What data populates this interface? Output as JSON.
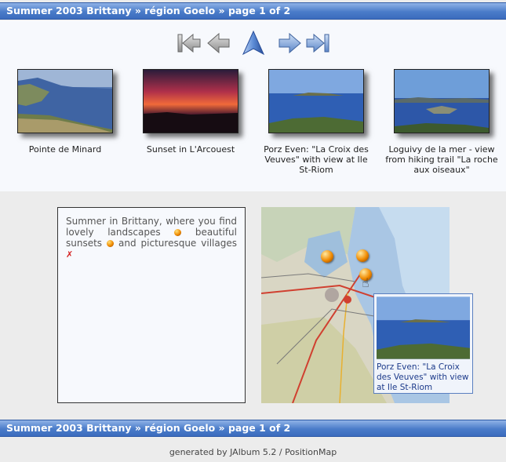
{
  "header": {
    "title": "Summer 2003 Brittany » région Goelo » page 1 of 2"
  },
  "nav": {
    "buttons": [
      {
        "name": "first-page-icon"
      },
      {
        "name": "previous-page-icon"
      },
      {
        "name": "up-icon"
      },
      {
        "name": "next-page-icon"
      },
      {
        "name": "last-page-icon"
      }
    ]
  },
  "thumbnails": [
    {
      "caption": "Pointe de Minard"
    },
    {
      "caption": "Sunset in L'Arcouest"
    },
    {
      "caption": "Porz Even: \"La Croix des Veuves\" with view at Ile St-Riom"
    },
    {
      "caption": "Loguivy de la mer - view from hiking trail \"La roche aux oiseaux\""
    }
  ],
  "description": {
    "part1": "Summer in Brittany, where you find lovely landscapes",
    "part2": "beautiful sunsets",
    "part3": "and picturesque villages"
  },
  "map": {
    "tooltip": "Porz Even: \"La Croix des Veuves\" with view at Ile St-Riom"
  },
  "footer": {
    "prefix": "generated by",
    "jalbum": "JAlbum 5.2",
    "separator": "/",
    "positionmap": "PositionMap"
  }
}
